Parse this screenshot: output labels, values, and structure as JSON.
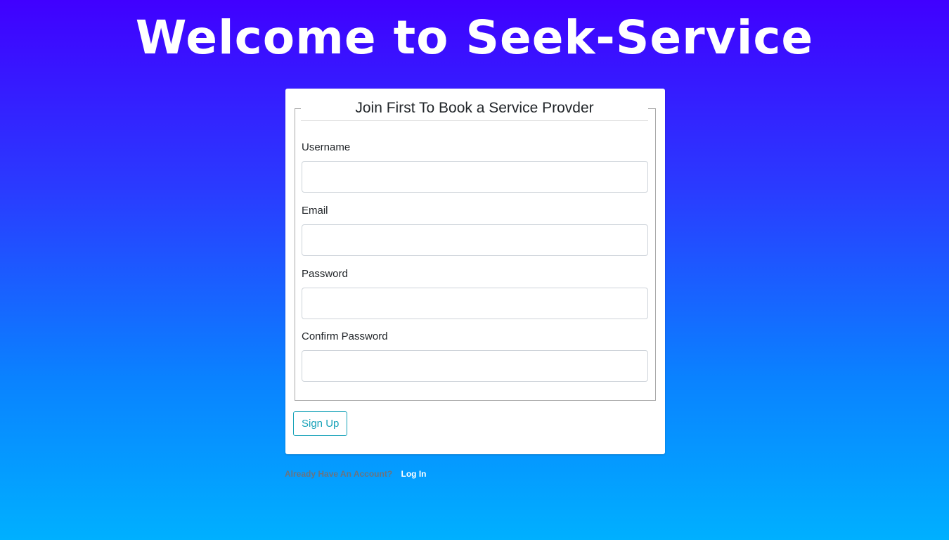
{
  "header": {
    "title": "Welcome to Seek-Service"
  },
  "form": {
    "legend": "Join First To Book a Service Provder",
    "fields": [
      {
        "label": "Username",
        "value": "",
        "placeholder": ""
      },
      {
        "label": "Email",
        "value": "",
        "placeholder": ""
      },
      {
        "label": "Password",
        "value": "",
        "placeholder": ""
      },
      {
        "label": "Confirm Password",
        "value": "",
        "placeholder": ""
      }
    ],
    "submit_label": "Sign Up"
  },
  "footer": {
    "prompt": "Already Have An Account?",
    "login_label": "Log In"
  },
  "colors": {
    "gradient_top": "#4000ff",
    "gradient_bottom": "#00b0ff",
    "button_accent": "#17a2b8"
  }
}
